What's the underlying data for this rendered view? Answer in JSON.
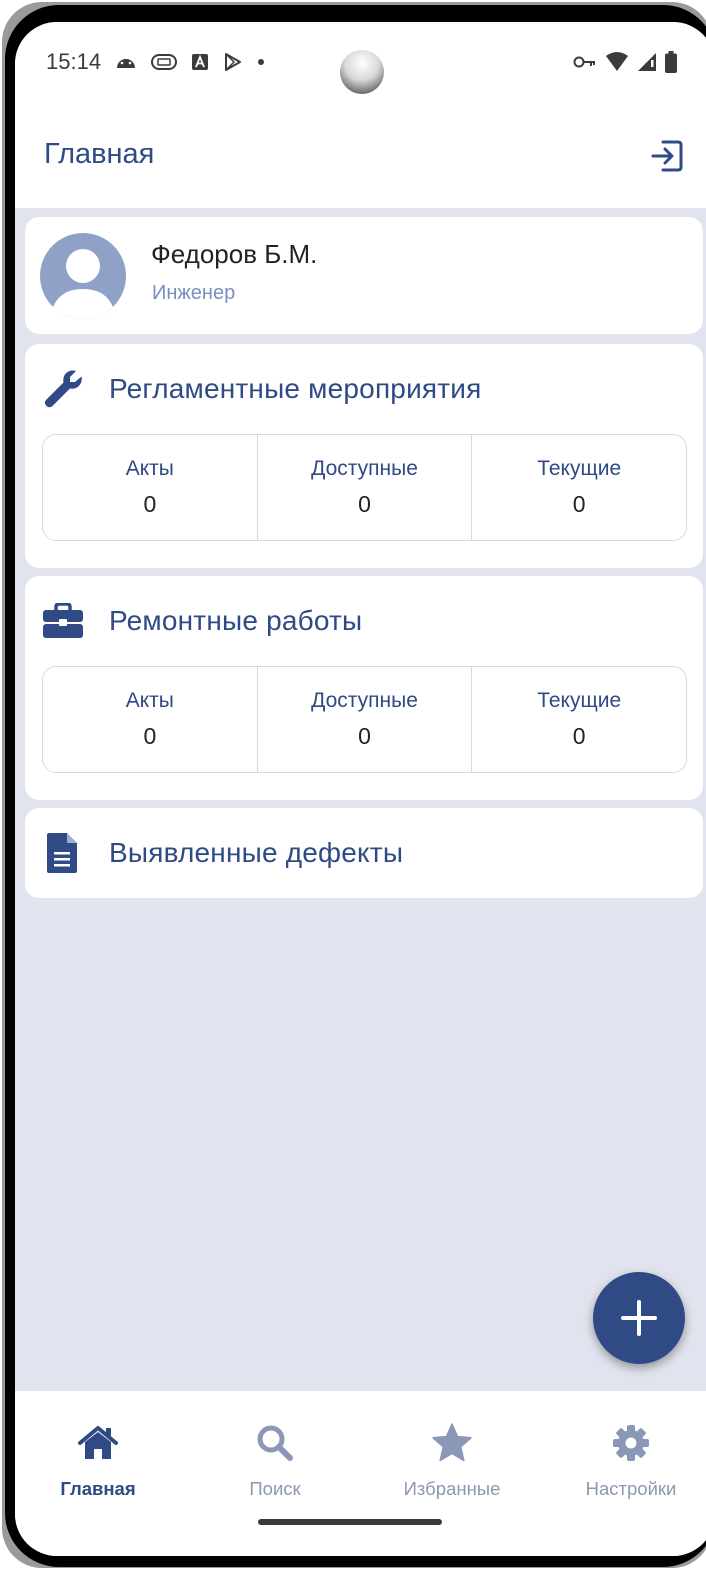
{
  "status_bar": {
    "time": "15:14",
    "left_icons": [
      "android-icon",
      "vpn-badge-icon",
      "a-square-icon",
      "play-icon",
      "dot-icon"
    ],
    "right_icons": [
      "key-icon",
      "wifi-icon",
      "signal-icon",
      "battery-icon"
    ]
  },
  "app_bar": {
    "title": "Главная",
    "action_icon": "logout-icon"
  },
  "profile": {
    "name": "Федоров Б.М.",
    "role": "Инженер"
  },
  "sections": [
    {
      "title": "Регламентные мероприятия",
      "icon": "wrench-icon",
      "stats": [
        {
          "label": "Акты",
          "value": "0"
        },
        {
          "label": "Доступные",
          "value": "0"
        },
        {
          "label": "Текущие",
          "value": "0"
        }
      ]
    },
    {
      "title": "Ремонтные работы",
      "icon": "briefcase-icon",
      "stats": [
        {
          "label": "Акты",
          "value": "0"
        },
        {
          "label": "Доступные",
          "value": "0"
        },
        {
          "label": "Текущие",
          "value": "0"
        }
      ]
    },
    {
      "title": "Выявленные дефекты",
      "icon": "document-icon"
    }
  ],
  "fab": {
    "icon": "plus-icon"
  },
  "bottom_nav": [
    {
      "label": "Главная",
      "icon": "home-icon",
      "active": true
    },
    {
      "label": "Поиск",
      "icon": "search-icon",
      "active": false
    },
    {
      "label": "Избранные",
      "icon": "star-icon",
      "active": false
    },
    {
      "label": "Настройки",
      "icon": "gear-icon",
      "active": false
    }
  ],
  "colors": {
    "primary": "#2f4a84",
    "inactive": "#8a97b5",
    "background": "#e1e4ee"
  }
}
